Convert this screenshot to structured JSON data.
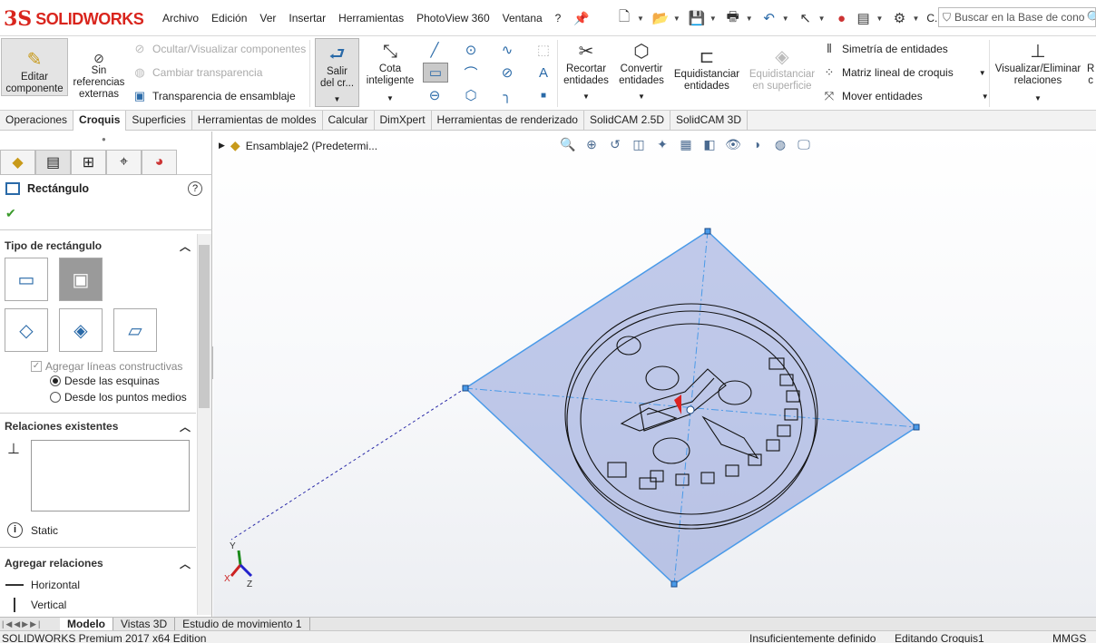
{
  "app": {
    "logo_ds": "3S",
    "logo_text": "SOLIDWORKS"
  },
  "menu": [
    "Archivo",
    "Edición",
    "Ver",
    "Insertar",
    "Herramientas",
    "PhotoView 360",
    "Ventana",
    "?"
  ],
  "quick_access": {
    "extra_label": "C..."
  },
  "search": {
    "placeholder": "Buscar en la Base de cono"
  },
  "ribbon": {
    "editar_componente": "Editar\ncomponente",
    "sin_referencias": "Sin\nreferencias\nexternas",
    "ocultar": "Ocultar/Visualizar componentes",
    "cambiar": "Cambiar transparencia",
    "transparencia": "Transparencia de ensamblaje",
    "salir": "Salir\ndel cr...",
    "cota": "Cota\ninteligente",
    "recortar": "Recortar\nentidades",
    "convertir": "Convertir\nentidades",
    "equid_ent": "Equidistanciar\nentidades",
    "equid_sup": "Equidistanciar\nen superficie",
    "simetria": "Simetría de entidades",
    "matriz": "Matriz lineal de croquis",
    "mover": "Mover entidades",
    "visualizar": "Visualizar/Eliminar\nrelaciones",
    "cut_r": "R\nc"
  },
  "tabs": [
    "Operaciones",
    "Croquis",
    "Superficies",
    "Herramientas de moldes",
    "Calcular",
    "DimXpert",
    "Herramientas de renderizado",
    "SolidCAM 2.5D",
    "SolidCAM 3D"
  ],
  "active_tab": "Croquis",
  "panel": {
    "title": "Rectángulo",
    "help": "?",
    "accept": "✔",
    "tipo_header": "Tipo de rectángulo",
    "agregar_lineas": "Agregar líneas constructivas",
    "desde_esquinas": "Desde las esquinas",
    "desde_medios": "Desde los puntos medios",
    "relaciones_header": "Relaciones existentes",
    "static": "Static",
    "agregar_rel_header": "Agregar relaciones",
    "horizontal": "Horizontal",
    "vertical": "Vertical"
  },
  "tree": {
    "item": "Ensamblaje2  (Predetermi..."
  },
  "bottom_tabs": [
    "Modelo",
    "Vistas 3D",
    "Estudio de movimiento 1"
  ],
  "active_bottom": "Modelo",
  "status": {
    "left": "SOLIDWORKS Premium 2017 x64 Edition",
    "def": "Insuficientemente definido",
    "editing": "Editando Croquis1",
    "units": "MMGS"
  },
  "triad": {
    "y": "Y",
    "x": "X",
    "z": "Z"
  }
}
